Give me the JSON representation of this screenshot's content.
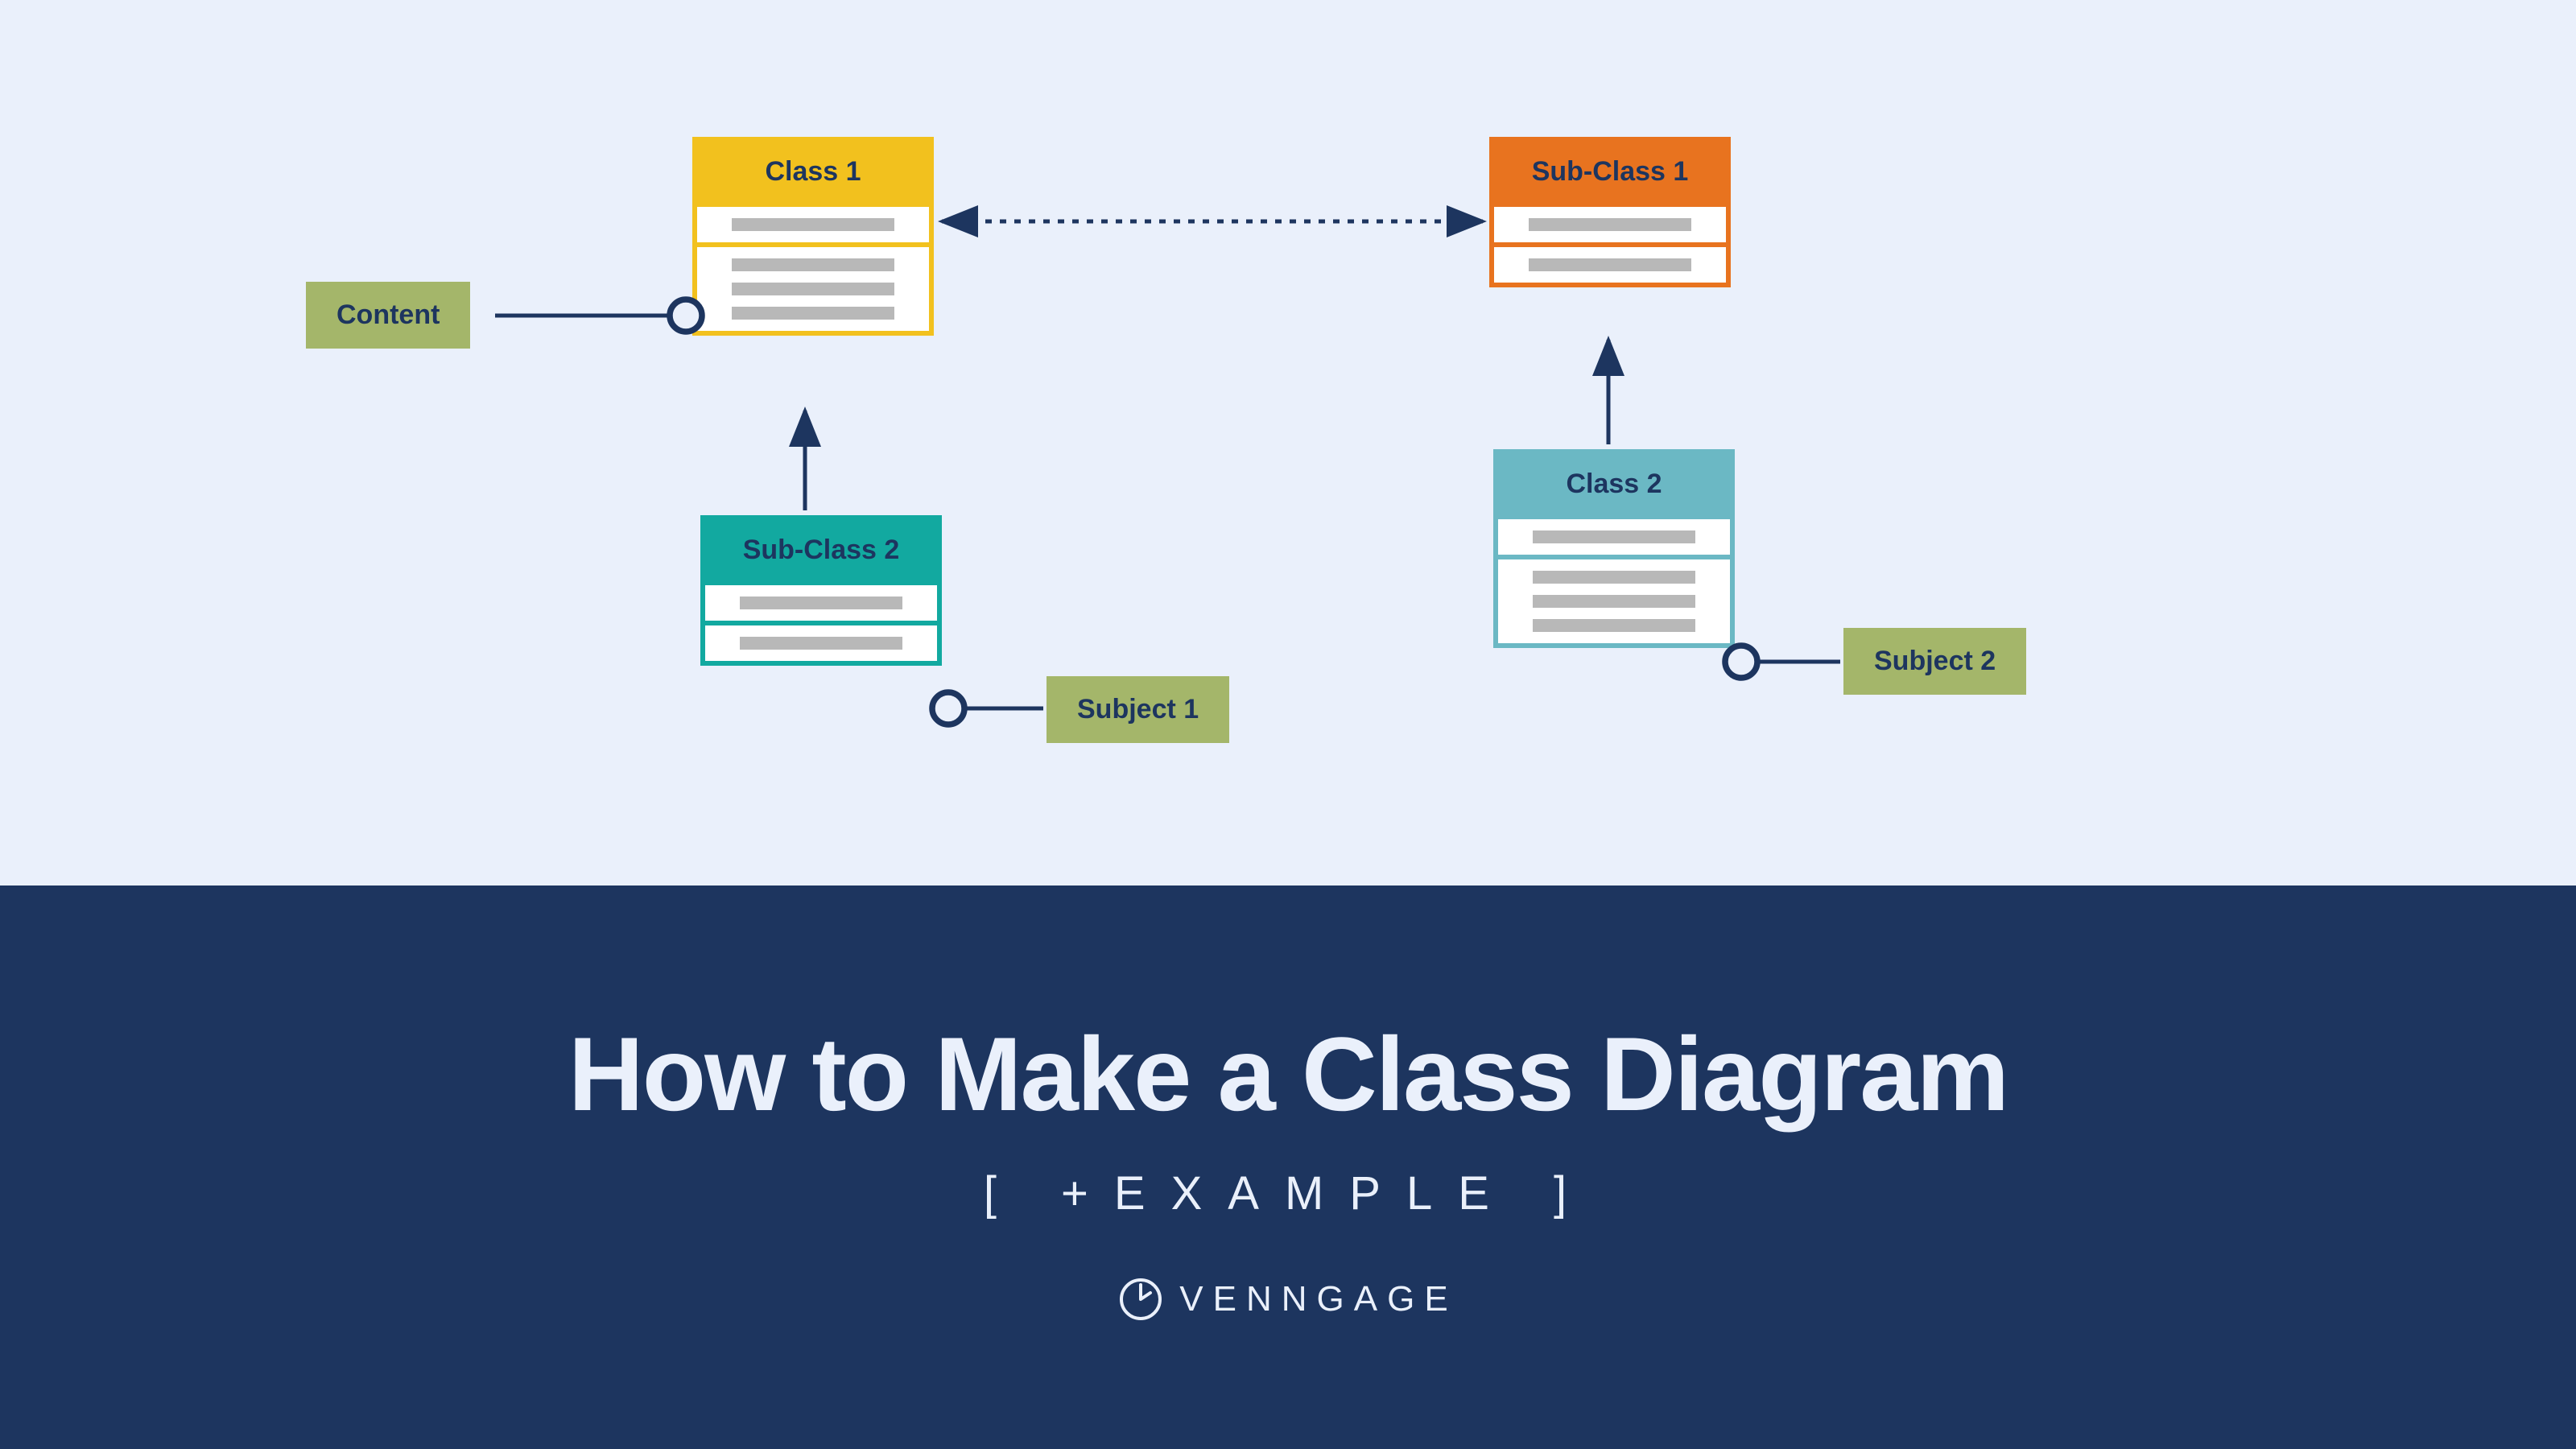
{
  "diagram": {
    "boxes": {
      "class1": {
        "title": "Class 1"
      },
      "subclass2": {
        "title": "Sub-Class 2"
      },
      "subclass1": {
        "title": "Sub-Class 1"
      },
      "class2": {
        "title": "Class 2"
      }
    },
    "labels": {
      "content": "Content",
      "subject1": "Subject 1",
      "subject2": "Subject 2"
    }
  },
  "title": "How to Make a Class Diagram",
  "subtitle": "[ +EXAMPLE ]",
  "brand": "VENNGAGE",
  "colors": {
    "bg_top": "#eaf0fb",
    "bg_bottom": "#1d355f",
    "yellow": "#f2c11e",
    "teal": "#12a9a0",
    "orange": "#e8731f",
    "lightteal": "#6bb8c4",
    "olive": "#a4b66a",
    "navy_text": "#1d355f"
  }
}
